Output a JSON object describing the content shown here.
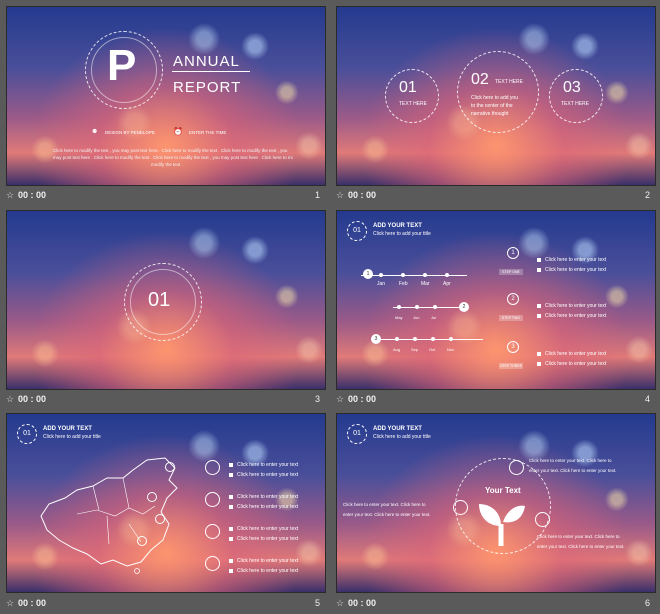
{
  "slides": [
    {
      "number": "1",
      "time": "00 : 00",
      "logo_letter": "P",
      "title_line1": "ANNUAL",
      "title_line2": "REPORT",
      "designer": "DESIGN BY PENELOPE",
      "enter_time": "ENTER THE TIME",
      "body_line1": "Click here to modify the text , you may post text here . Click here to modify the text . Click here to modify the text , you",
      "body_line2": "may post text here . Click here to modify the text . Click here to modify the text , you may post text here . Click here to modify the",
      "body_line3": "modify the text ."
    },
    {
      "number": "2",
      "time": "00 : 00",
      "circles": [
        {
          "num": "01",
          "label": "TEXT HERE"
        },
        {
          "num": "02",
          "label": "TEXT HERE"
        },
        {
          "num": "03",
          "label": "TEXT HERE"
        }
      ],
      "center_line1": "Click here to add you",
      "center_line2": "to the center of the",
      "center_line3": "narrative thought"
    },
    {
      "number": "3",
      "time": "00 : 00",
      "circle_num": "01"
    },
    {
      "number": "4",
      "time": "00 : 00",
      "header_num": "01",
      "header_title": "ADD YOUR TEXT",
      "header_sub": "Click here to add your title",
      "timeline1": {
        "marker": "1",
        "months": [
          "Jan",
          "Feb",
          "Mar",
          "Apr"
        ]
      },
      "timeline2": {
        "marker": "2",
        "months": [
          "May",
          "Jun",
          "Jul"
        ]
      },
      "timeline3": {
        "marker": "3",
        "months": [
          "Aug",
          "Sep",
          "Oct",
          "Nov"
        ]
      },
      "steps": [
        {
          "pin": "1",
          "tag": "STEP ONE"
        },
        {
          "pin": "2",
          "tag": "STEP TWO"
        },
        {
          "pin": "3",
          "tag": "STEP THREE"
        }
      ],
      "bullet_text": "Click here to enter your text"
    },
    {
      "number": "5",
      "time": "00 : 00",
      "header_num": "01",
      "header_title": "ADD YOUR TEXT",
      "header_sub": "Click here to add your title",
      "bullet_text": "Click here to enter your text"
    },
    {
      "number": "6",
      "time": "00 : 00",
      "header_num": "01",
      "header_title": "ADD YOUR TEXT",
      "header_sub": "Click here to add your title",
      "center_label": "Your Text",
      "left_text_line1": "Click here to enter your text. Click here to",
      "left_text_line2": "enter your text. Click here to enter your text.",
      "topright_line1": "Click here to enter your text. Click here to",
      "topright_line2": "enter your text. Click here to enter your text.",
      "bottomright_line1": "Click here to enter your text. Click here to",
      "bottomright_line2": "enter your text. Click here to enter your text."
    }
  ],
  "icons": {
    "star": "star-icon",
    "person": "person-icon",
    "clock": "clock-icon"
  }
}
